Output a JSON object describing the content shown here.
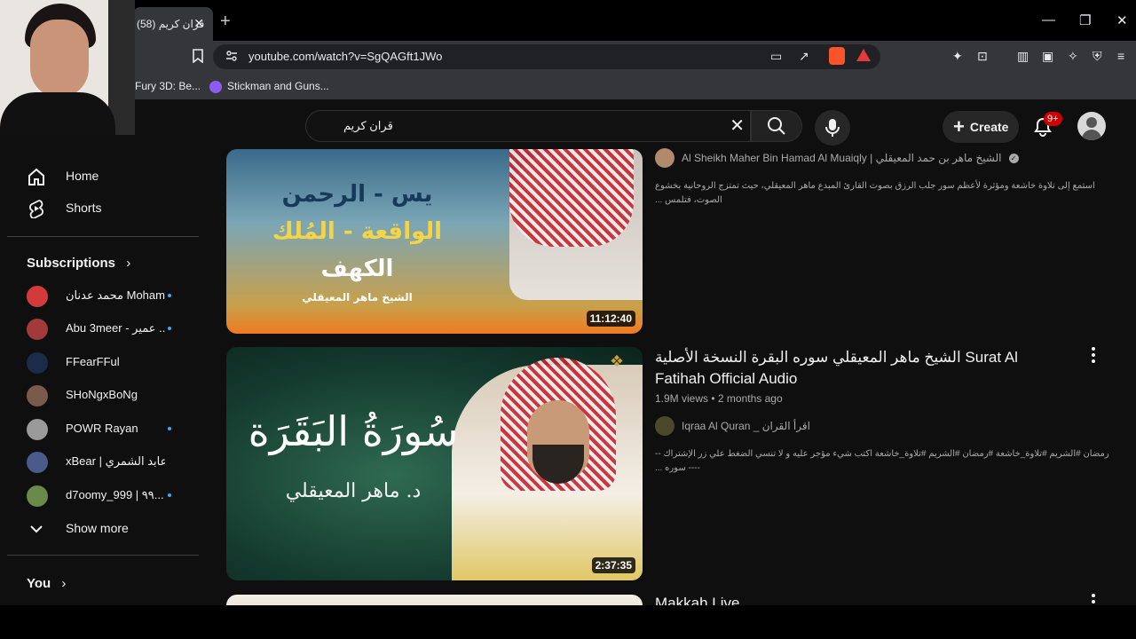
{
  "browser": {
    "tab_title": "(58) قران كريم",
    "url": "youtube.com/watch?v=SgQAGft1JWo",
    "bookmarks": [
      "Fury 3D: Be...",
      "Stickman and Guns..."
    ]
  },
  "youtube": {
    "search_query": "قران كريم",
    "create_label": "Create",
    "notifications_badge": "9+",
    "sidebar": {
      "nav": [
        {
          "label": "Home",
          "icon": "home-icon"
        },
        {
          "label": "Shorts",
          "icon": "shorts-icon"
        }
      ],
      "subscriptions_title": "Subscriptions",
      "subscriptions": [
        {
          "name": "محمد عدنان Moham...",
          "color": "#d33b3b",
          "new": true
        },
        {
          "name": "Abu 3meer - عمير ...",
          "color": "#a33a3a",
          "new": true
        },
        {
          "name": "FFearFFul",
          "color": "#1b2b4a",
          "new": false
        },
        {
          "name": "SHoNgxBoNg",
          "color": "#7a5a4a",
          "new": false
        },
        {
          "name": "POWR Rayan",
          "color": "#9a9a9a",
          "new": true
        },
        {
          "name": "xBear | ابو عابد الشمري",
          "color": "#4a5a8a",
          "new": false
        },
        {
          "name": "d7oomy_999 | ٩٩...",
          "color": "#6a8a4a",
          "new": true
        }
      ],
      "show_more": "Show more",
      "you_label": "You"
    },
    "results": [
      {
        "thumb_text_line1": "يس - الرحمن",
        "thumb_text_line2": "الواقعة - المُلك",
        "thumb_text_line3": "الكهف",
        "thumb_caption": "الشيخ ماهر المعيقلي",
        "duration": "11:12:40",
        "channel": "Al Sheikh Maher Bin Hamad Al Muaiqly | الشيخ ماهر بن حمد المعيقلي",
        "verified": true,
        "description": "استمع إلى تلاوة خاشعة ومؤثرة لأعظم سور جلب الرزق بصوت القارئ المبدع ماهر المعيقلي، حيث تمتزج الروحانية بخشوع الصوت، فتلمس ..."
      },
      {
        "thumb_title": "سُورَةُ البَقَرَة",
        "thumb_caption": "د. ماهر المعيقلي",
        "duration": "2:37:35",
        "title": "الشيخ ماهر المعيقلي سوره البقرة النسخة الأصلية Surat Al Fatihah Official Audio",
        "views": "1.9M views",
        "age": "2 months ago",
        "channel": "Iqraa Al Quran _ اقرأ القران",
        "description": "رمضان #الشريم #تلاوة_خاشعة #رمضان #الشريم #تلاوة_خاشعة اكتب شيء مؤجر عليه و لا تنسي الضغط علي زر الإشتراك ------ سوره ..."
      },
      {
        "title": "Makkah Live"
      }
    ]
  },
  "colors": {
    "youtube_bg": "#0f0f0f",
    "chrome_bg": "#35363a",
    "accent_red": "#cc0000",
    "link_blue": "#3ea6ff"
  }
}
